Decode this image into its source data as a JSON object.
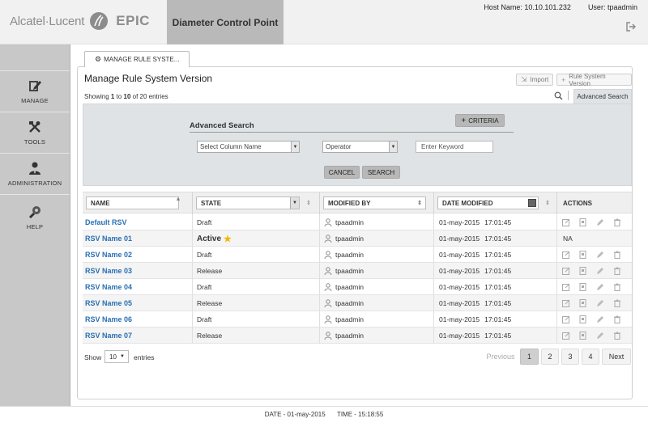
{
  "header": {
    "brand": "Alcatel·Lucent",
    "product": "EPIC",
    "app_title": "Diameter Control Point",
    "host_label": "Host Name:",
    "host_value": "10.10.101.232",
    "user_label": "User:",
    "user_value": "tpaadmin"
  },
  "sidebar": {
    "items": [
      {
        "label": "MANAGE",
        "icon": "manage-icon"
      },
      {
        "label": "TOOLS",
        "icon": "tools-icon"
      },
      {
        "label": "ADMINISTRATION",
        "icon": "administration-icon"
      },
      {
        "label": "HELP",
        "icon": "help-icon"
      }
    ]
  },
  "page_tab": "MANAGE RULE SYSTE...",
  "panel": {
    "title": "Manage Rule System Version",
    "import_label": "Import",
    "add_version_label": "Rule System Version",
    "showing_prefix": "Showing ",
    "showing_from": "1",
    "showing_to_word": " to ",
    "showing_to": "10",
    "showing_suffix": " of 20 entries",
    "adv_tab": "Advanced Search"
  },
  "advanced_search": {
    "title": "Advanced Search",
    "criteria_label": "CRITERIA",
    "column_placeholder": "Select Column Name",
    "operator_placeholder": "Operator",
    "keyword_placeholder": "Enter Keyword",
    "cancel_label": "CANCEL",
    "search_label": "SEARCH"
  },
  "table": {
    "headers": {
      "name": "NAME",
      "state": "STATE",
      "modified_by": "MODIFIED BY",
      "date_modified": "DATE MODIFIED",
      "actions": "ACTIONS"
    },
    "rows": [
      {
        "name": "Default RSV",
        "state": "Draft",
        "modified_by": "tpaadmin",
        "date": "01-may-2015",
        "time": "17:01:45",
        "actions": "icons"
      },
      {
        "name": "RSV Name 01",
        "state": "Active",
        "modified_by": "tpaadmin",
        "date": "01-may-2015",
        "time": "17:01:45",
        "actions": "NA"
      },
      {
        "name": "RSV Name 02",
        "state": "Draft",
        "modified_by": "tpaadmin",
        "date": "01-may-2015",
        "time": "17:01:45",
        "actions": "icons"
      },
      {
        "name": "RSV Name 03",
        "state": "Release",
        "modified_by": "tpaadmin",
        "date": "01-may-2015",
        "time": "17:01:45",
        "actions": "icons"
      },
      {
        "name": "RSV Name 04",
        "state": "Draft",
        "modified_by": "tpaadmin",
        "date": "01-may-2015",
        "time": "17:01:45",
        "actions": "icons"
      },
      {
        "name": "RSV Name 05",
        "state": "Release",
        "modified_by": "tpaadmin",
        "date": "01-may-2015",
        "time": "17:01:45",
        "actions": "icons"
      },
      {
        "name": "RSV Name 06",
        "state": "Draft",
        "modified_by": "tpaadmin",
        "date": "01-may-2015",
        "time": "17:01:45",
        "actions": "icons"
      },
      {
        "name": "RSV Name 07",
        "state": "Release",
        "modified_by": "tpaadmin",
        "date": "01-may-2015",
        "time": "17:01:45",
        "actions": "icons"
      }
    ]
  },
  "pagination": {
    "show_label": "Show",
    "page_size": "10",
    "entries_label": "entries",
    "previous_label": "Previous",
    "pages": [
      "1",
      "2",
      "3",
      "4"
    ],
    "current_page": "1",
    "next_label": "Next"
  },
  "footer": {
    "date_text": "DATE - 01-may-2015",
    "time_text": "TIME - 15:18:55"
  },
  "colors": {
    "link": "#2a6fb3",
    "sidebar": "#c8c8c8",
    "adv_panel": "#dfe3e6",
    "star": "#f2b500"
  }
}
